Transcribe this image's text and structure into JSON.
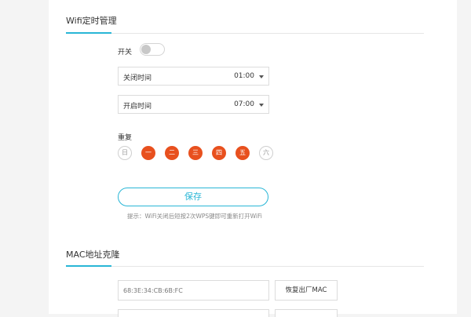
{
  "wifi_timer": {
    "title": "Wifi定时管理",
    "switch_label": "开关",
    "switch_on": false,
    "close_time": {
      "label": "关闭时间",
      "value": "01:00"
    },
    "open_time": {
      "label": "开启时间",
      "value": "07:00"
    },
    "repeat_label": "重复",
    "days": [
      {
        "label": "日",
        "selected": false
      },
      {
        "label": "一",
        "selected": true
      },
      {
        "label": "二",
        "selected": true
      },
      {
        "label": "三",
        "selected": true
      },
      {
        "label": "四",
        "selected": true
      },
      {
        "label": "五",
        "selected": true
      },
      {
        "label": "六",
        "selected": false
      }
    ],
    "save_label": "保存",
    "hint": "提示：WiFi关闭后短按2次WPS键即可重新打开WiFi"
  },
  "mac_clone": {
    "title": "MAC地址克隆",
    "mac_value": "68:3E:34:CB:6B:FC",
    "restore_label": "恢复出厂MAC"
  },
  "colors": {
    "accent": "#29b6d6",
    "day_selected": "#e8501e"
  }
}
